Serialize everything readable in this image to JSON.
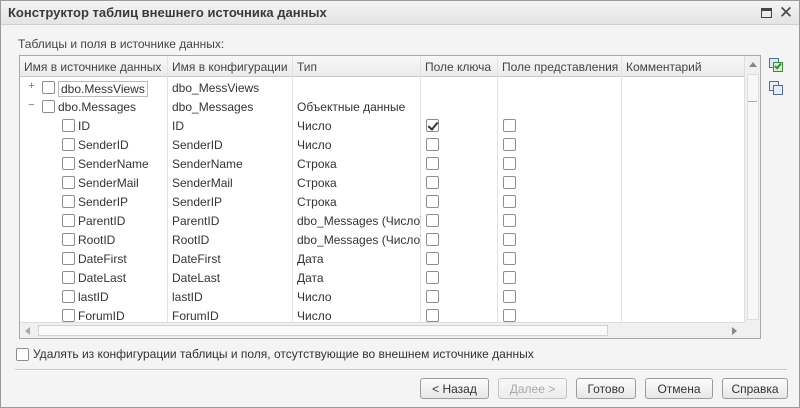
{
  "window": {
    "title": "Конструктор таблиц внешнего источника данных"
  },
  "section_label": "Таблицы и поля в источнике данных:",
  "columns": [
    "Имя в источнике данных",
    "Имя в конфигурации",
    "Тип",
    "Поле ключа",
    "Поле представления",
    "Комментарий"
  ],
  "rows": [
    {
      "level": 0,
      "toggle": "+",
      "checked": false,
      "source_name": "dbo.MessViews",
      "config_name": "dbo_MessViews",
      "type": "",
      "key": null,
      "presentation": null,
      "comment": ""
    },
    {
      "level": 0,
      "toggle": "−",
      "checked": false,
      "source_name": "dbo.Messages",
      "config_name": "dbo_Messages",
      "type": "Объектные данные",
      "key": null,
      "presentation": null,
      "comment": ""
    },
    {
      "level": 1,
      "checked": false,
      "source_name": "ID",
      "config_name": "ID",
      "type": "Число",
      "key": true,
      "presentation": false,
      "comment": ""
    },
    {
      "level": 1,
      "checked": false,
      "source_name": "SenderID",
      "config_name": "SenderID",
      "type": "Число",
      "key": false,
      "presentation": false,
      "comment": ""
    },
    {
      "level": 1,
      "checked": false,
      "source_name": "SenderName",
      "config_name": "SenderName",
      "type": "Строка",
      "key": false,
      "presentation": false,
      "comment": ""
    },
    {
      "level": 1,
      "checked": false,
      "source_name": "SenderMail",
      "config_name": "SenderMail",
      "type": "Строка",
      "key": false,
      "presentation": false,
      "comment": ""
    },
    {
      "level": 1,
      "checked": false,
      "source_name": "SenderIP",
      "config_name": "SenderIP",
      "type": "Строка",
      "key": false,
      "presentation": false,
      "comment": ""
    },
    {
      "level": 1,
      "checked": false,
      "source_name": "ParentID",
      "config_name": "ParentID",
      "type": "dbo_Messages (Число)",
      "key": false,
      "presentation": false,
      "comment": ""
    },
    {
      "level": 1,
      "checked": false,
      "source_name": "RootID",
      "config_name": "RootID",
      "type": "dbo_Messages (Число)",
      "key": false,
      "presentation": false,
      "comment": ""
    },
    {
      "level": 1,
      "checked": false,
      "source_name": "DateFirst",
      "config_name": "DateFirst",
      "type": "Дата",
      "key": false,
      "presentation": false,
      "comment": ""
    },
    {
      "level": 1,
      "checked": false,
      "source_name": "DateLast",
      "config_name": "DateLast",
      "type": "Дата",
      "key": false,
      "presentation": false,
      "comment": ""
    },
    {
      "level": 1,
      "checked": false,
      "source_name": "lastID",
      "config_name": "lastID",
      "type": "Число",
      "key": false,
      "presentation": false,
      "comment": ""
    },
    {
      "level": 1,
      "checked": false,
      "source_name": "ForumID",
      "config_name": "ForumID",
      "type": "Число",
      "key": false,
      "presentation": false,
      "comment": ""
    }
  ],
  "side_buttons": {
    "check_all_icon": "check-all-icon",
    "uncheck_all_icon": "uncheck-all-icon"
  },
  "delete_missing": {
    "checked": false,
    "label": "Удалять из конфигурации таблицы и поля, отсутствующие во внешнем источнике данных"
  },
  "buttons": {
    "back": "< Назад",
    "next": "Далее >",
    "done": "Готово",
    "cancel": "Отмена",
    "help": "Справка"
  }
}
